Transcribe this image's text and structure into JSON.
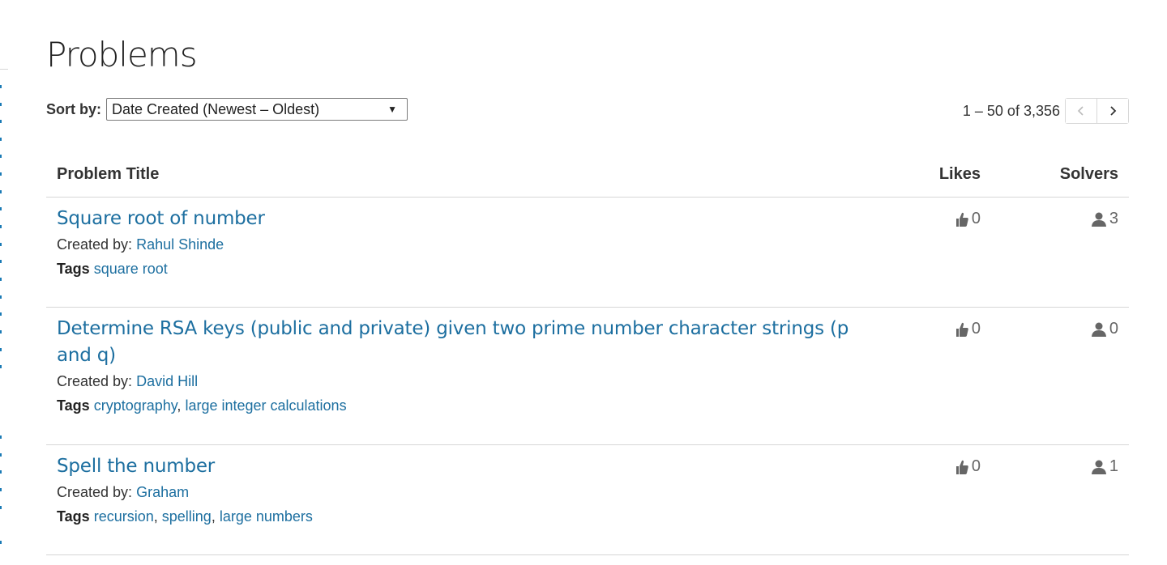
{
  "page": {
    "title": "Problems"
  },
  "sort": {
    "label": "Sort by:",
    "selected": "Date Created (Newest – Oldest)"
  },
  "pagination": {
    "range_text": "1 – 50 of 3,356"
  },
  "table": {
    "headers": {
      "title": "Problem Title",
      "likes": "Likes",
      "solvers": "Solvers"
    },
    "created_by_label": "Created by:",
    "tags_label": "Tags",
    "rows": [
      {
        "title": "Square root of number",
        "author": "Rahul Shinde",
        "tags": [
          "square root"
        ],
        "likes": "0",
        "solvers": "3"
      },
      {
        "title": "Determine RSA keys (public and private) given two prime number character strings (p and q)",
        "author": "David Hill",
        "tags": [
          "cryptography",
          "large integer calculations"
        ],
        "likes": "0",
        "solvers": "0"
      },
      {
        "title": "Spell the number",
        "author": "Graham",
        "tags": [
          "recursion",
          "spelling",
          "large numbers"
        ],
        "likes": "0",
        "solvers": "1"
      }
    ]
  },
  "colors": {
    "link": "#1d6fa0",
    "text": "#333333",
    "divider": "#d6d6d6",
    "icon": "#666666"
  },
  "icons": {
    "likes": "thumbs-up-icon",
    "solvers": "person-icon",
    "prev": "chevron-left-icon",
    "next": "chevron-right-icon",
    "dropdown": "caret-down-icon"
  }
}
